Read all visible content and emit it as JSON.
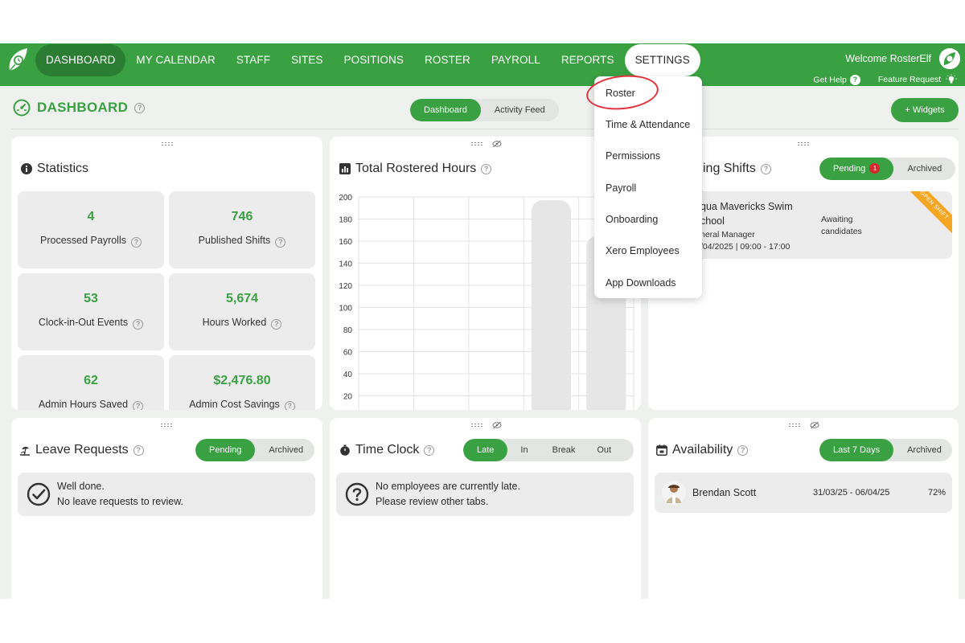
{
  "nav": {
    "items": [
      "DASHBOARD",
      "MY CALENDAR",
      "STAFF",
      "SITES",
      "POSITIONS",
      "ROSTER",
      "PAYROLL",
      "REPORTS",
      "SETTINGS"
    ],
    "welcome": "Welcome RosterElf",
    "get_help": "Get Help",
    "feature_request": "Feature Request"
  },
  "page": {
    "title": "DASHBOARD",
    "tabs": [
      "Dashboard",
      "Activity Feed"
    ],
    "widgets_button": "+ Widgets"
  },
  "statistics": {
    "title": "Statistics",
    "tiles": [
      {
        "value": "4",
        "label": "Processed Payrolls"
      },
      {
        "value": "746",
        "label": "Published Shifts"
      },
      {
        "value": "53",
        "label": "Clock-in-Out Events"
      },
      {
        "value": "5,674",
        "label": "Hours Worked"
      },
      {
        "value": "62",
        "label": "Admin Hours Saved"
      },
      {
        "value": "$2,476.80",
        "label": "Admin Cost Savings"
      }
    ]
  },
  "rostered_hours": {
    "title": "Total Rostered Hours"
  },
  "chart_data": {
    "type": "bar",
    "title": "Total Rostered Hours",
    "ylim": [
      0,
      200
    ],
    "yticks": [
      20,
      40,
      60,
      80,
      100,
      120,
      140,
      160,
      180,
      200
    ],
    "values": [
      2,
      5,
      0,
      197,
      165
    ],
    "grid": true
  },
  "open_shifts": {
    "title_visible": "ing Shifts",
    "tabs": [
      "Pending",
      "Archived"
    ],
    "pending_count": "1",
    "row": {
      "line1": "qua Mavericks Swim",
      "line2": "chool",
      "line3": "neral Manager",
      "line4": "/04/2025 | 09:00 - 17:00",
      "status_line1": "Awaiting",
      "status_line2": "candidates",
      "ribbon": "OPEN SHIFT"
    }
  },
  "leave": {
    "title": "Leave Requests",
    "tabs": [
      "Pending",
      "Archived"
    ],
    "msg1": "Well done.",
    "msg2": "No leave requests to review."
  },
  "timeclock": {
    "title": "Time Clock",
    "tabs": [
      "Late",
      "In",
      "Break",
      "Out"
    ],
    "msg1": "No employees are currently late.",
    "msg2": "Please review other tabs."
  },
  "availability": {
    "title": "Availability",
    "tabs": [
      "Last 7 Days",
      "Archived"
    ],
    "row": {
      "name": "Brendan Scott",
      "range": "31/03/25 - 06/04/25",
      "percent": "72%"
    }
  },
  "settings_menu": [
    "Roster",
    "Time & Attendance",
    "Permissions",
    "Payroll",
    "Onboarding",
    "Xero Employees",
    "App Downloads"
  ],
  "colors": {
    "brand": "#3aa143",
    "brand_dark": "#2a7d32",
    "highlight": "#e0333b",
    "badge": "#d9262c",
    "ribbon": "#f5a623"
  }
}
